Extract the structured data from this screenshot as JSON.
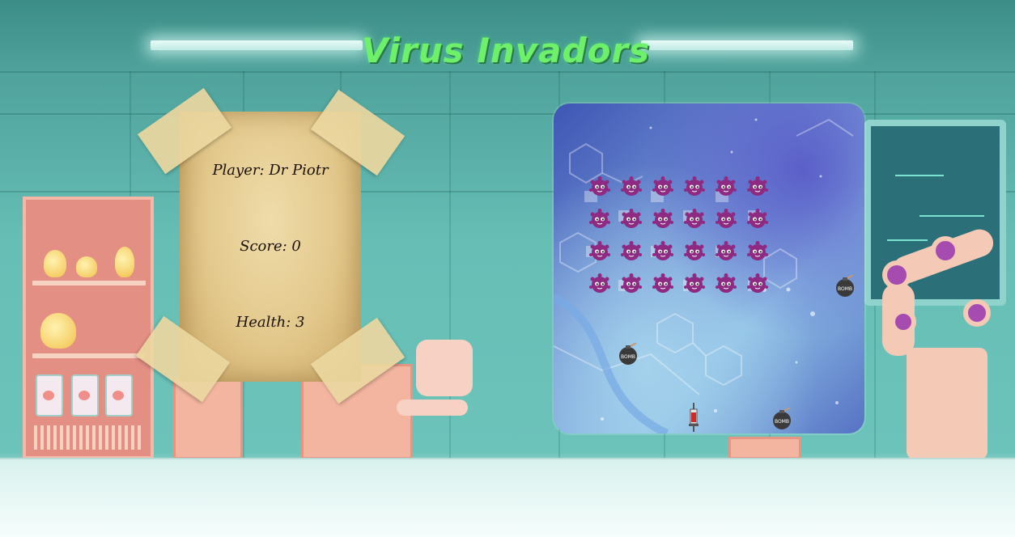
{
  "game": {
    "title": "Virus Invadors",
    "player_label": "Player: Dr Piotr",
    "score_label": "Score: 0",
    "health_label": "Health: 3"
  },
  "colors": {
    "title": "#6ff06a",
    "virus": "#8e2a82",
    "bomb": "#3a3a3a",
    "parchment": "#e2c78a"
  },
  "board": {
    "virus_rows": 4,
    "virus_cols": 6,
    "bomb_label": "BOMB"
  }
}
